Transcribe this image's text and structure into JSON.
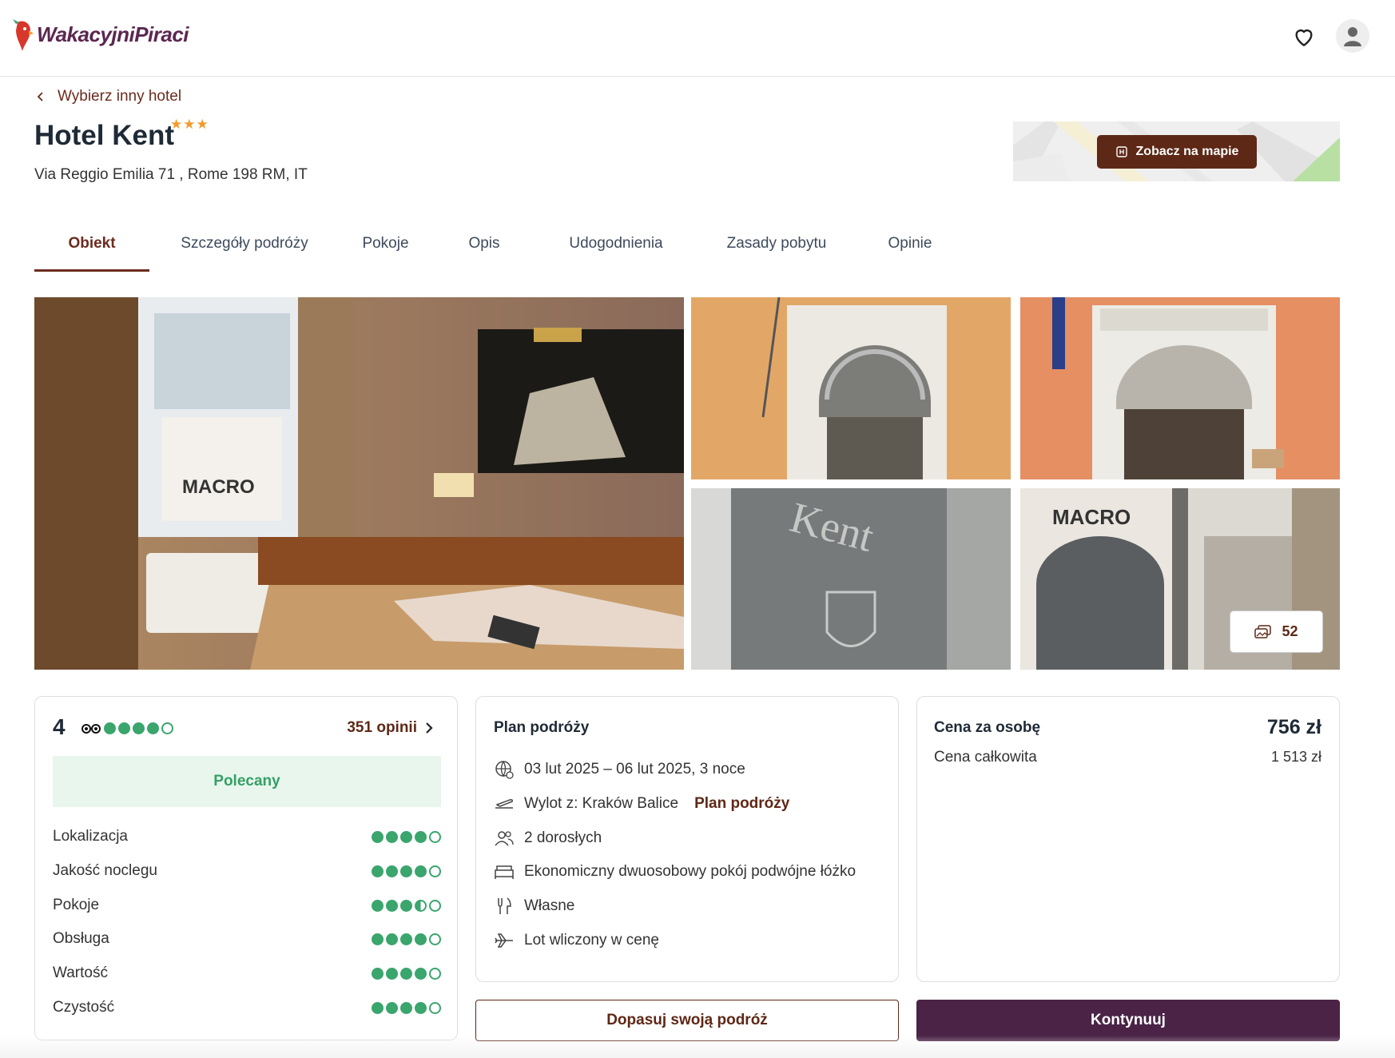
{
  "header": {
    "logo_text": "WakacyjniPiraci",
    "favorites_icon": "heart-icon",
    "profile_icon": "user-icon"
  },
  "back_link": "Wybierz inny hotel",
  "hotel": {
    "name": "Hotel Kent",
    "stars": 3,
    "stars_text": "★★★",
    "address": "Via Reggio Emilia 71 , Rome 198 RM, IT"
  },
  "map": {
    "button_label": "Zobacz na mapie"
  },
  "tabs": [
    {
      "label": "Obiekt",
      "active": true
    },
    {
      "label": "Szczegóły podróży",
      "active": false
    },
    {
      "label": "Pokoje",
      "active": false
    },
    {
      "label": "Opis",
      "active": false
    },
    {
      "label": "Udogodnienia",
      "active": false
    },
    {
      "label": "Zasady pobytu",
      "active": false
    },
    {
      "label": "Opinie",
      "active": false
    }
  ],
  "gallery": {
    "photo_count": "52"
  },
  "rating": {
    "score": "4",
    "score_value": 4,
    "opinions_label": "351 opinii",
    "recommended_label": "Polecany",
    "categories": [
      {
        "label": "Lokalizacja",
        "value": 4
      },
      {
        "label": "Jakość noclegu",
        "value": 4
      },
      {
        "label": "Pokoje",
        "value": 3.5
      },
      {
        "label": "Obsługa",
        "value": 4
      },
      {
        "label": "Wartość",
        "value": 4
      },
      {
        "label": "Czystość",
        "value": 4
      }
    ]
  },
  "plan": {
    "title": "Plan podróży",
    "dates": "03 lut 2025 – 06 lut 2025, 3 noce",
    "departure": "Wylot z: Kraków Balice",
    "departure_link": "Plan podróży",
    "guests": "2 dorosłych",
    "room": "Ekonomiczny dwuosobowy pokój podwójne łóżko",
    "board": "Własne",
    "flight": "Lot wliczony w cenę"
  },
  "price": {
    "per_person_label": "Cena za osobę",
    "per_person_value": "756 zł",
    "total_label": "Cena całkowita",
    "total_value": "1 513 zł"
  },
  "buttons": {
    "customize": "Dopasuj swoją podróż",
    "continue": "Kontynuuj"
  },
  "colors": {
    "brand": "#5b2750",
    "accent_brown": "#5e2816",
    "rating_green": "#3aa56d",
    "primary_button": "#4a2346"
  }
}
